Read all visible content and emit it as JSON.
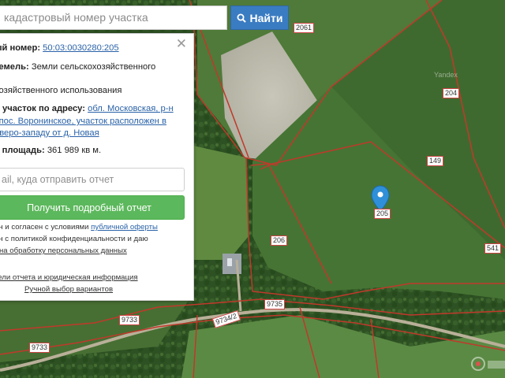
{
  "search": {
    "placeholder": "кадастровый номер участка",
    "button_label": "Найти"
  },
  "panel": {
    "cadastral_label": "ый номер:",
    "cadastral_value": "50:03:0030280:205",
    "category_label": "земель:",
    "category_value_1": "Земли сельскохозяйственного",
    "category_value_2": "я",
    "use_value": "хозяйственного использования",
    "address_label": "й участок по адресу:",
    "address_line_1": "обл. Московская, р-н",
    "address_line_2": "спос. Воронинское, участок расположен в",
    "address_line_3": "еверо-западу от д. Новая",
    "area_label": "я площадь:",
    "area_value": "361 989 кв м.",
    "email_placeholder": "ail, куда отправить отчет",
    "report_button": "Получить подробный отчет",
    "consent_1_pre": "ен и согласен с условиями",
    "consent_1_link": "публичной оферты",
    "consent_2": "ен с политикой конфиденциальности и даю",
    "consent_3": "на обработку персональных данных",
    "details_link": "тели отчета и юридическая информация",
    "manual_link": "Ручной выбор вариантов"
  },
  "map": {
    "parcel_labels": [
      {
        "id": "2061",
        "text": "2061"
      },
      {
        "id": "204",
        "text": "204"
      },
      {
        "id": "149",
        "text": "149"
      },
      {
        "id": "205",
        "text": "205"
      },
      {
        "id": "206",
        "text": "206"
      },
      {
        "id": "541",
        "text": "541"
      },
      {
        "id": "9735",
        "text": "9735"
      },
      {
        "id": "9733a",
        "text": "9733"
      },
      {
        "id": "9733b",
        "text": "9733"
      },
      {
        "id": "9734",
        "text": "9734/2"
      }
    ],
    "watermark": "Yandex",
    "colors": {
      "boundary": "#c0392b",
      "accent": "#3a7cc2",
      "button_green": "#5cb85c",
      "pin": "#2f8fd8"
    }
  }
}
